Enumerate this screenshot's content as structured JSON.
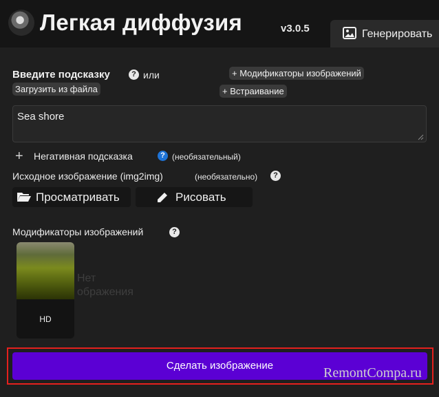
{
  "header": {
    "title": "Легкая диффузия",
    "version": "v3.0.5",
    "tab_label": "Генерировать"
  },
  "prompt": {
    "label": "Введите подсказку",
    "or": "или",
    "load_file": "Загрузить из файла",
    "modifiers_button": "+ Модификаторы изображений",
    "embedding_button": "+ Встраивание",
    "value": "Sea shore"
  },
  "negative": {
    "label": "Негативная подсказка",
    "optional": "(необязательный)"
  },
  "img2img": {
    "label": "Исходное изображение (img2img)",
    "optional": "(необязательно)",
    "browse": "Просматривать",
    "draw": "Рисовать"
  },
  "modifiers": {
    "label": "Модификаторы изображений",
    "card_label": "HD",
    "ghost_line1": "Нет",
    "ghost_line2": "ображения"
  },
  "make_button": "Сделать изображение",
  "watermark": "RemontCompa.ru",
  "colors": {
    "accent": "#5b00d4",
    "highlight_border": "#e5201d",
    "help_blue": "#1e73d6"
  }
}
